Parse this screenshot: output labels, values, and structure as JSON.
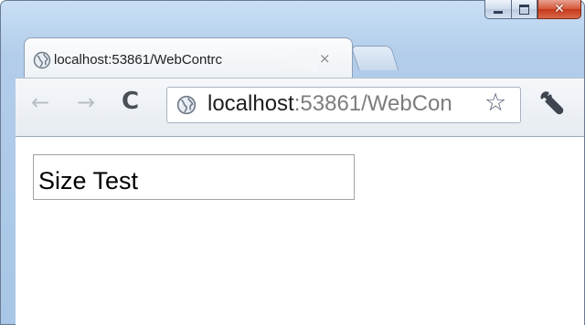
{
  "window": {
    "caption": {
      "minimize": "minimize-icon",
      "maximize": "maximize-icon",
      "close": "✕"
    }
  },
  "tab": {
    "title": "localhost:53861/WebContrc",
    "close": "×",
    "icon": "globe-icon"
  },
  "toolbar": {
    "back": "←",
    "forward": "→",
    "reload": "C",
    "url_host": "localhost",
    "url_rest": ":53861/WebCon",
    "star": "☆",
    "wrench": "wrench-icon"
  },
  "content": {
    "textbox_value": "Size Test"
  }
}
